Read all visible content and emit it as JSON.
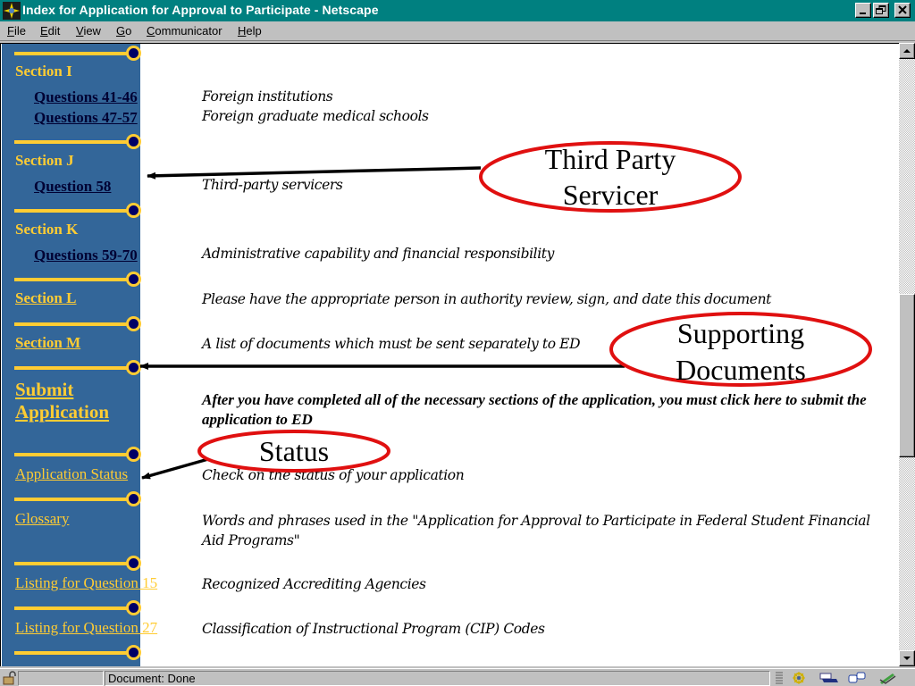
{
  "window": {
    "title": "Index for Application for Approval to Participate - Netscape",
    "controls": [
      "minimize",
      "restore",
      "close"
    ]
  },
  "menubar": {
    "items": [
      {
        "label": "File",
        "accel": "F"
      },
      {
        "label": "Edit",
        "accel": "E"
      },
      {
        "label": "View",
        "accel": "V"
      },
      {
        "label": "Go",
        "accel": "G"
      },
      {
        "label": "Communicator",
        "accel": "C"
      },
      {
        "label": "Help",
        "accel": "H"
      }
    ]
  },
  "sidebar": {
    "section_i": {
      "heading": "Section I",
      "links": [
        "Questions 41-46",
        "Questions 47-57"
      ]
    },
    "section_j": {
      "heading": "Section J",
      "links": [
        "Question 58"
      ]
    },
    "section_k": {
      "heading": "Section K",
      "links": [
        "Questions 59-70"
      ]
    },
    "section_l": {
      "heading": "Section L"
    },
    "section_m": {
      "heading": "Section M"
    },
    "submit": {
      "line1": "Submit",
      "line2": "Application"
    },
    "application_status": "Application Status",
    "glossary": "Glossary",
    "listing_q15": "Listing for Question 15",
    "listing_q27": "Listing for Question 27"
  },
  "descriptions": {
    "q41_46": "Foreign institutions",
    "q47_57": "Foreign graduate medical schools",
    "q58": "Third-party servicers",
    "q59_70": "Administrative capability and financial responsibility",
    "section_l": "Please have the appropriate person in authority review, sign, and date this document",
    "section_m": "A list of documents which must be sent separately to ED",
    "submit": "After you have completed all of the necessary sections of the application, you must click here to submit the application to ED",
    "status": "Check on the status of your application",
    "glossary": "Words and phrases used in the \"Application for Approval to Participate in Federal Student Financial Aid Programs\"",
    "listing_q15": "Recognized Accrediting Agencies",
    "listing_q27": "Classification of Instructional Program (CIP) Codes"
  },
  "callouts": {
    "third_party": {
      "line1": "Third Party",
      "line2": "Servicer"
    },
    "supporting": {
      "line1": "Supporting",
      "line2": "Documents"
    },
    "status": {
      "line1": "Status"
    }
  },
  "colors": {
    "titlebar": "#008080",
    "sidebar": "#336699",
    "sidebar_accent": "#ffcc33",
    "knob": "#000066",
    "callout_border": "#e01010"
  },
  "statusbar": {
    "text": "Document: Done",
    "icons": [
      "security-lock-icon",
      "component-bar-icon",
      "navigator-icon",
      "mailbox-icon",
      "discussion-icon",
      "composer-icon"
    ]
  },
  "scrollbar": {
    "position_fraction": 0.55
  }
}
